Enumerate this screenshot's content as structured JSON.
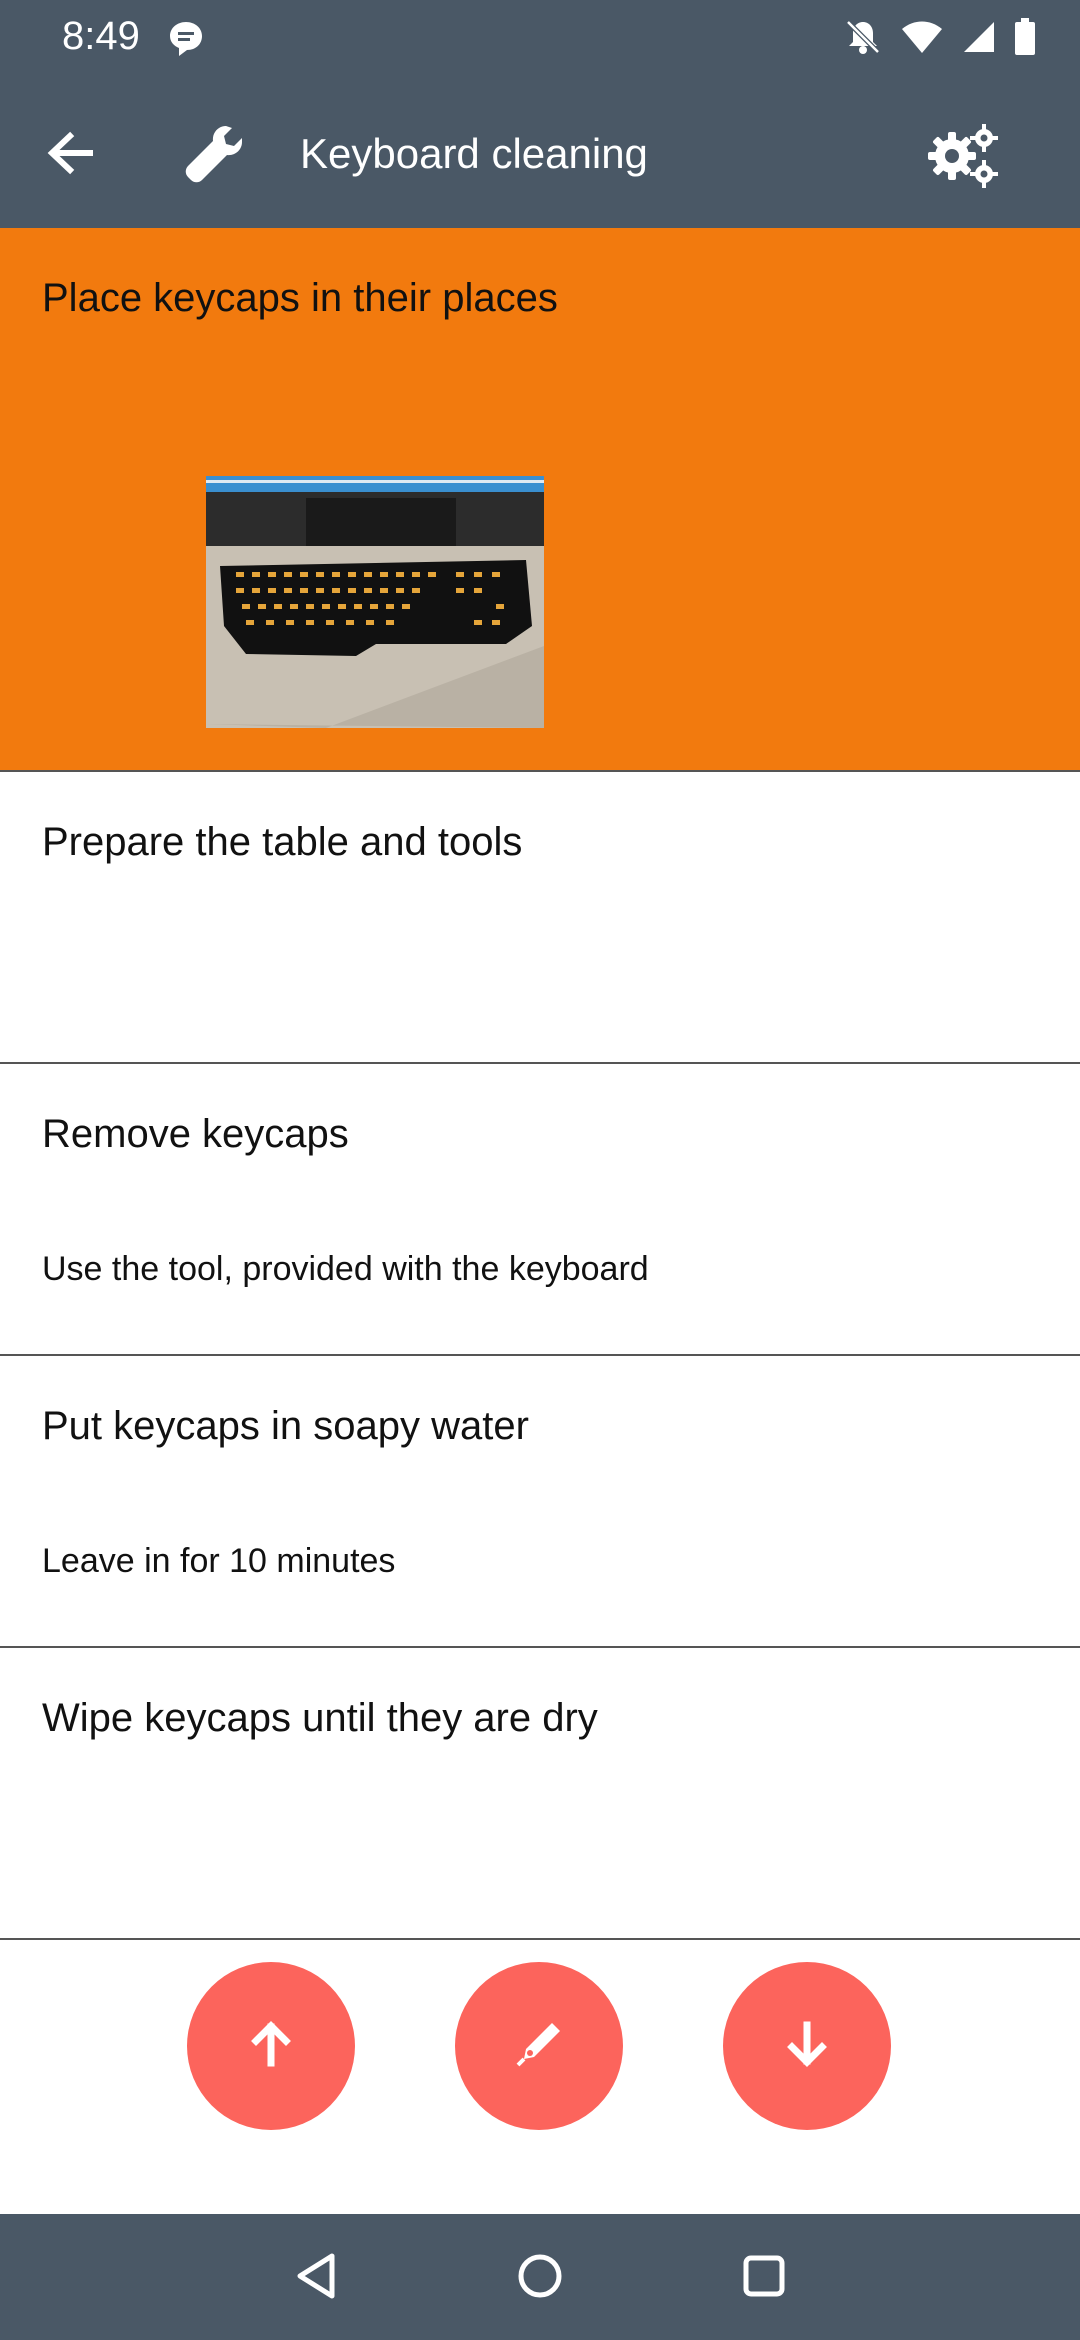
{
  "status_bar": {
    "time": "8:49",
    "icons": [
      "message-icon",
      "notifications-off-icon",
      "wifi-icon",
      "signal-icon",
      "battery-icon"
    ]
  },
  "app_bar": {
    "title": "Keyboard cleaning",
    "icons": [
      "back-arrow-icon",
      "wrench-icon",
      "settings-gears-icon"
    ]
  },
  "steps": [
    {
      "title": "Place keycaps in their places",
      "description": "",
      "has_image": true,
      "active": true
    },
    {
      "title": "Prepare the table and tools",
      "description": "",
      "has_image": false,
      "active": false
    },
    {
      "title": "Remove keycaps",
      "description": "Use the tool, provided with the keyboard",
      "has_image": false,
      "active": false
    },
    {
      "title": "Put keycaps in soapy water",
      "description": "Leave in for 10 minutes",
      "has_image": false,
      "active": false
    },
    {
      "title": "Wipe keycaps until they are dry",
      "description": "",
      "has_image": false,
      "active": false
    }
  ],
  "actions": {
    "icons": [
      "arrow-up-icon",
      "edit-pen-icon",
      "arrow-down-icon"
    ]
  },
  "nav_bar": {
    "icons": [
      "nav-back-icon",
      "nav-home-icon",
      "nav-recents-icon"
    ]
  },
  "colors": {
    "bar": "#4a5866",
    "active_item": "#f27a0e",
    "fab": "#fc645c"
  }
}
